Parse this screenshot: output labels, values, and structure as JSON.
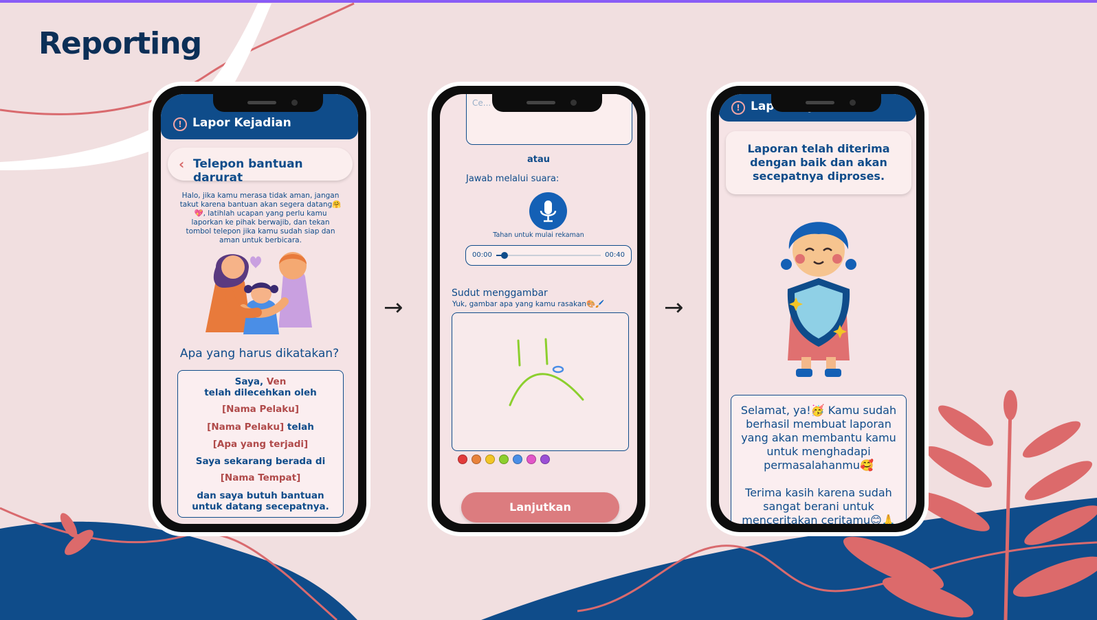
{
  "page_title": "Reporting",
  "arrows": [
    "→",
    "→"
  ],
  "phone1": {
    "appbar_title": "Lapor Kejadian",
    "back_label": "Telepon bantuan darurat",
    "intro": "Halo, jika kamu merasa tidak aman, jangan takut karena bantuan akan segera datang🤗💖, latihlah ucapan yang perlu kamu laporkan ke pihak berwajib, dan tekan tombol telepon jika kamu sudah siap dan aman untuk berbicara.",
    "question": "Apa yang harus dikatakan?",
    "script": {
      "line1_prefix": "Saya,",
      "line1_name": "Ven",
      "line2": "telah dilecehkan oleh",
      "line3": "[Nama Pelaku]",
      "line4_name": "[Nama Pelaku]",
      "line4_suffix": "telah",
      "line5": "[Apa yang terjadi]",
      "line6": "Saya sekarang berada di",
      "line7": "[Nama Tempat]",
      "line8": "dan saya butuh bantuan untuk datang secepatnya."
    }
  },
  "phone2": {
    "textarea_partial_text": "Ce... ...an saat ini..",
    "or_label": "atau",
    "voice_label": "Jawab melalui suara:",
    "mic_caption": "Tahan untuk mulai rekaman",
    "player": {
      "start_time": "00:00",
      "end_time": "00:40",
      "progress": 0.08
    },
    "draw_title": "Sudut menggambar",
    "draw_subtitle": "Yuk, gambar apa yang kamu rasakan🎨🖌️",
    "palette": [
      "#e23b3b",
      "#e8823b",
      "#f2c526",
      "#8ccf2e",
      "#4a8ee6",
      "#e255c8",
      "#9b4fd6"
    ],
    "cta_label": "Lanjutkan"
  },
  "phone3": {
    "appbar_title": "Lapor Kejadian",
    "confirmation": "Laporan telah diterima dengan baik dan akan secepatnya diproses.",
    "congrats_1": "Selamat, ya!🥳 Kamu sudah berhasil membuat laporan yang akan membantu kamu untuk menghadapi permasalahanmu🥰",
    "congrats_2": "Terima kasih karena sudah sangat berani untuk menceritakan ceritamu😊🙏"
  },
  "colors": {
    "brand_blue": "#0f4c8a",
    "accent_pink": "#dc7c7f",
    "background": "#f1dfe0"
  }
}
